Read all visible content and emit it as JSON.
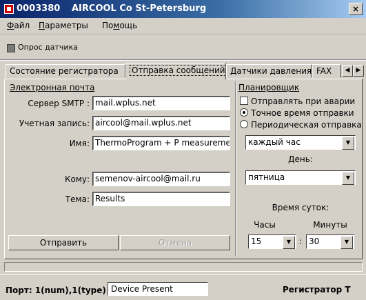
{
  "window": {
    "id": "0003380",
    "title": "AIRCOOL Co  St-Petersburg",
    "close_symbol": "×"
  },
  "menu": [
    {
      "first": "Ф",
      "rest": "айл"
    },
    {
      "first": "П",
      "rest": "араметры"
    },
    {
      "first": "По",
      "ul": "м",
      "rest": "ощь"
    }
  ],
  "poll": {
    "label": "Опрос датчика",
    "checked": true
  },
  "tabs": [
    {
      "label": "Состояние регистратора"
    },
    {
      "label": "Отправка сообщений",
      "active": true
    },
    {
      "label": "Датчики давления"
    },
    {
      "label": "FAX"
    }
  ],
  "tab_scroll": {
    "left": "◀",
    "right": "▶"
  },
  "email": {
    "title": "Электронная почта",
    "smtp_label": "Сервер SMTP :",
    "smtp_value": "mail.wplus.net",
    "account_label": "Учетная запись:",
    "account_value": "aircool@mail.wplus.net",
    "name_label": "Имя:",
    "name_value": "ThermoProgram + P measurement",
    "to_label": "Кому:",
    "to_value": "semenov-aircool@mail.ru",
    "subject_label": "Тема:",
    "subject_value": "Results",
    "send_button": "Отправить",
    "cancel_button": "Отмена"
  },
  "scheduler": {
    "title": "Планировщик",
    "opt_alarm": "Отправлять при аварии",
    "opt_exact": "Точное время отправки",
    "opt_periodic": "Периодическая отправка",
    "period_value": "каждый час",
    "day_label": "День:",
    "day_value": "пятница",
    "time_label": "Время суток:",
    "hours_label": "Часы",
    "minutes_label": "Минуты",
    "hours_value": "15",
    "minutes_value": "30",
    "colon": ":",
    "dropdown_arrow": "▼"
  },
  "status": {
    "port": "Порт: 1(num),1(type)",
    "device": "Device Present",
    "right": "Регистратор Т"
  }
}
